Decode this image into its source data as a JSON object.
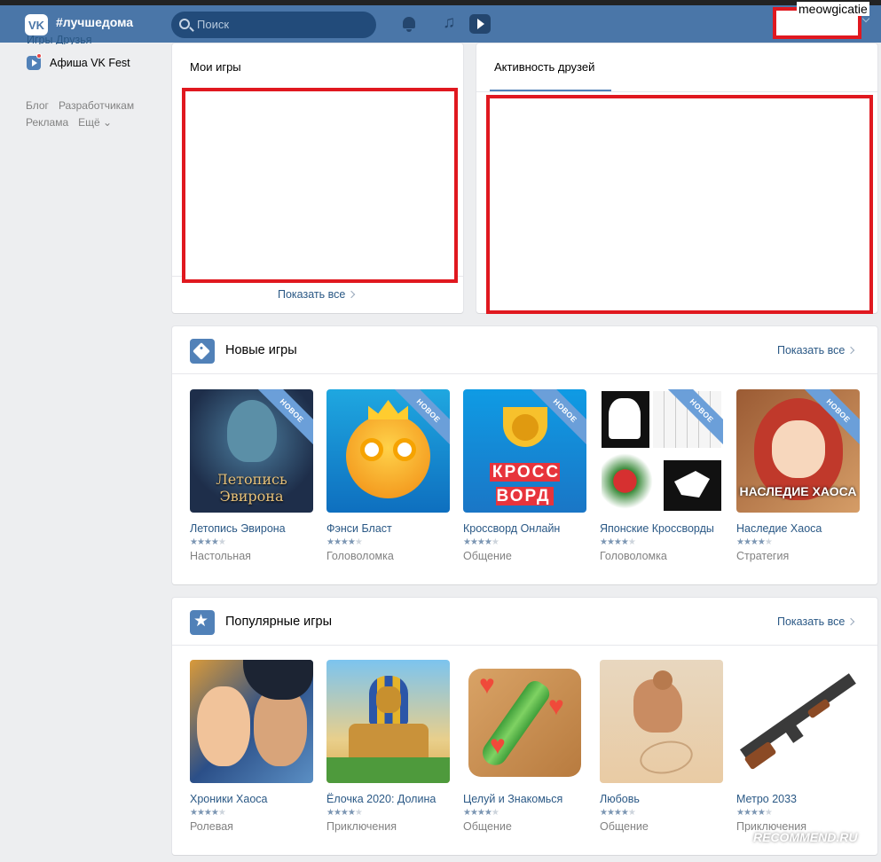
{
  "header": {
    "logo_text": "VK",
    "hashtag": "#лучшедома",
    "search_placeholder": "Поиск",
    "username": "meowgicatie",
    "music_glyph": "♫"
  },
  "sidebar": {
    "cut_item": "Игры Друзья",
    "item_fest": "Афиша VK Fest",
    "footer_row1": [
      "Блог",
      "Разработчикам"
    ],
    "footer_row2": [
      "Реклама",
      "Ещё ⌄"
    ]
  },
  "my_games": {
    "title": "Мои игры",
    "show_all": "Показать все"
  },
  "friends_activity": {
    "tab": "Активность друзей"
  },
  "new_games": {
    "title": "Новые игры",
    "show_all": "Показать все",
    "badge": "НОВОЕ",
    "items": [
      {
        "name": "Летопись Эвирона",
        "rating": 4,
        "genre": "Настольная",
        "art": "Летопись Эвирона"
      },
      {
        "name": "Фэнси Бласт",
        "rating": 4.5,
        "genre": "Головоломка",
        "art": ""
      },
      {
        "name": "Кроссворд Онлайн",
        "rating": 4,
        "genre": "Общение",
        "art": "КРОСС ВОРД"
      },
      {
        "name": "Японские Кроссворды",
        "rating": 4.5,
        "genre": "Головоломка",
        "art": ""
      },
      {
        "name": "Наследие Хаоса",
        "rating": 4,
        "genre": "Стратегия",
        "art": "НАСЛЕДИЕ ХАОСА"
      }
    ]
  },
  "popular_games": {
    "title": "Популярные игры",
    "show_all": "Показать все",
    "items": [
      {
        "name": "Хроники Хаоса",
        "rating": 4.5,
        "genre": "Ролевая"
      },
      {
        "name": "Ёлочка 2020: Долина",
        "rating": 4.5,
        "genre": "Приключения"
      },
      {
        "name": "Целуй и Знакомься",
        "rating": 4.5,
        "genre": "Общение"
      },
      {
        "name": "Любовь",
        "rating": 4.5,
        "genre": "Общение"
      },
      {
        "name": "Метро 2033",
        "rating": 4.5,
        "genre": "Приключения"
      }
    ]
  },
  "watermark": "RECOMMEND.RU",
  "colors": {
    "header": "#4a76a8",
    "link": "#2a5885",
    "redaction": "#e0181f"
  }
}
